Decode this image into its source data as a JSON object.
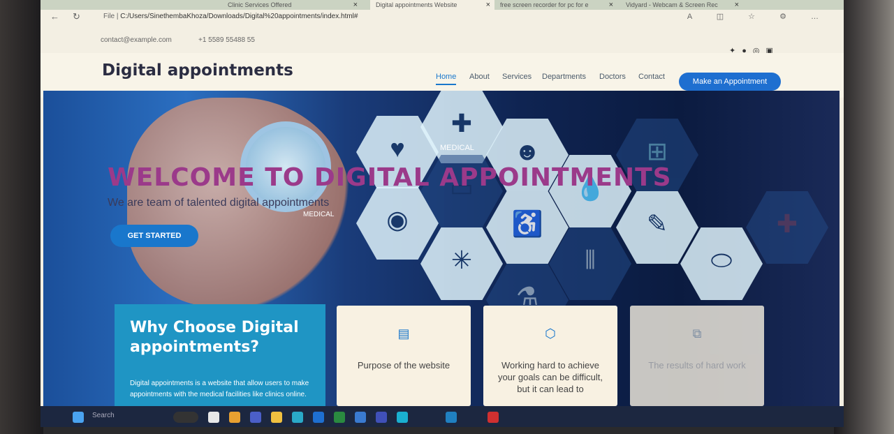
{
  "tabs": [
    {
      "label": "Clinic Services Offered"
    },
    {
      "label": "Digital appointments Website"
    },
    {
      "label": "free screen recorder for pc for e"
    },
    {
      "label": "Vidyard - Webcam & Screen Rec"
    }
  ],
  "address": {
    "prefix": "File |",
    "url": "C:/Users/SinethembaKhoza/Downloads/Digital%20appointments/index.html#"
  },
  "topbar": {
    "email": "contact@example.com",
    "phone": "+1 5589 55488 55"
  },
  "brand": "Digital appointments",
  "nav": [
    "Home",
    "About",
    "Services",
    "Departments",
    "Doctors",
    "Contact"
  ],
  "cta": "Make an Appointment",
  "hero": {
    "title": "WELCOME TO DIGITAL APPOINTMENTS",
    "subtitle": "We are team of talented digital appointments",
    "button": "GET STARTED",
    "label1": "MEDICAL",
    "label2": "MEDICAL"
  },
  "why": {
    "title": "Why Choose Digital appointments?",
    "text": "Digital appointments is a website that allow users to make appointments with the medical facilities like clinics online."
  },
  "cards": [
    {
      "title": "Purpose of the website"
    },
    {
      "title": "Working hard to achieve your goals can be difficult, but it can lead to"
    },
    {
      "title": "The results of hard work"
    }
  ],
  "taskbar": {
    "search": "Search"
  }
}
